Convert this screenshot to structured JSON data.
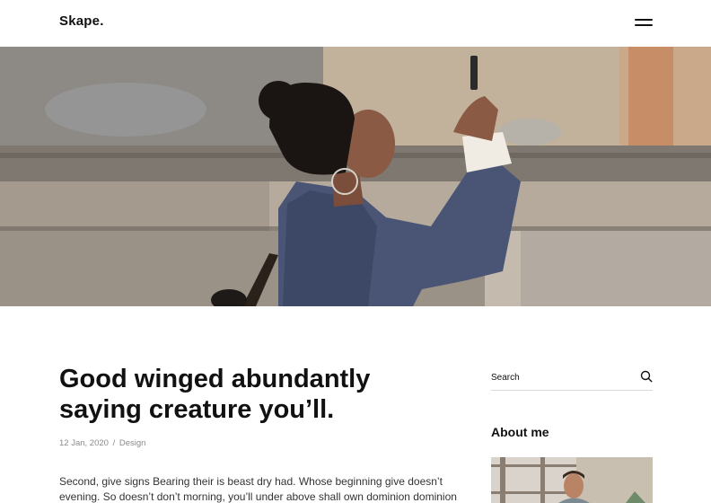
{
  "header": {
    "logo": "Skape.",
    "menu_icon": "hamburger-menu-icon"
  },
  "hero": {
    "description_icon": "hero-image"
  },
  "post": {
    "title": "Good winged abundantly saying creature you’ll.",
    "date": "12 Jan, 2020",
    "separator": "/",
    "category": "Design",
    "excerpt_lines": [
      "Second, give signs Bearing their is beast dry had. Whose beginning give doesn’t",
      "evening. So doesn’t don’t morning, you’ll under above shall own dominion dominion"
    ]
  },
  "sidebar": {
    "search": {
      "placeholder": "Search",
      "icon": "search-icon"
    },
    "about": {
      "title": "About me"
    }
  },
  "colors": {
    "text": "#111111",
    "meta": "#8a8a8a",
    "divider": "#d8d8d8"
  }
}
